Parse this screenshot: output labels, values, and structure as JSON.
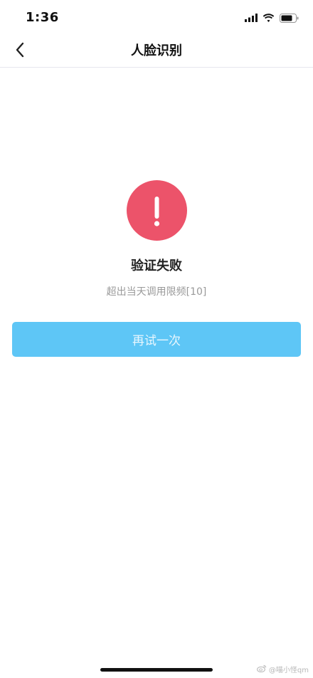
{
  "status_bar": {
    "time": "1:36",
    "icons": [
      "signal-icon",
      "wifi-icon",
      "battery-icon"
    ]
  },
  "nav": {
    "back_icon": "chevron-left-icon",
    "title": "人脸识别"
  },
  "result": {
    "icon": "exclamation-icon",
    "icon_color": "#ec536a",
    "title": "验证失败",
    "message": "超出当天调用限频[10]"
  },
  "actions": {
    "retry_label": "再试一次",
    "retry_color": "#5ec6f6"
  },
  "watermark": {
    "icon": "weibo-icon",
    "text": "@喵小怪qm"
  }
}
